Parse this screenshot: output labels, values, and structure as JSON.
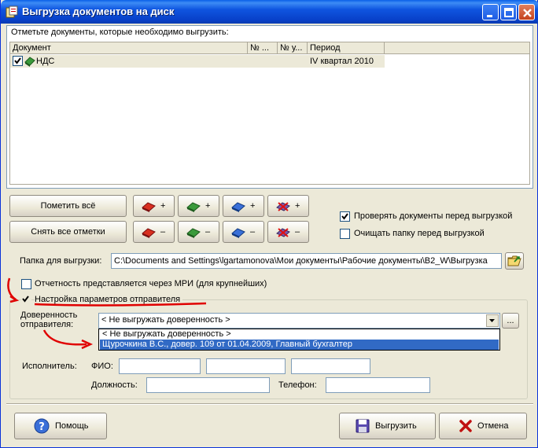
{
  "window": {
    "title": "Выгрузка документов на диск",
    "colors": {
      "titlebar": "#0840c8",
      "face": "#ece9d8",
      "selection": "#316ac5",
      "annotation": "#e00000"
    }
  },
  "documents_panel": {
    "hint": "Отметьте документы, которые необходимо выгрузить:",
    "columns": [
      "Документ",
      "№ ...",
      "№ у...",
      "Период"
    ],
    "rows": [
      {
        "checked": true,
        "document": "НДС",
        "num1": "",
        "num2": "",
        "period": "IV квартал 2010"
      }
    ]
  },
  "buttons": {
    "mark_all": "Пометить всё",
    "unmark_all": "Снять все отметки",
    "plus": "+",
    "minus": "–",
    "help": "Помощь",
    "export": "Выгрузить",
    "cancel": "Отмена",
    "ellipsis": "..."
  },
  "options": {
    "check_documents": {
      "label": "Проверять документы перед выгрузкой",
      "checked": true
    },
    "clear_folder": {
      "label": "Очищать папку перед выгрузкой",
      "checked": false
    }
  },
  "folder": {
    "label": "Папка для выгрузки:",
    "value": "C:\\Documents and Settings\\lgartamonova\\Мои документы\\Рабочие документы\\B2_W\\Выгрузка"
  },
  "mri": {
    "label": "Отчетность представляется через МРИ (для крупнейших)",
    "checked": false
  },
  "sender": {
    "label": "Настройка параметров отправителя",
    "checked": true,
    "proxy_label": "Доверенность отправителя:",
    "proxy_value": "< Не выгружать доверенность >",
    "proxy_options": [
      "< Не выгружать доверенность >",
      "Щурочкина В.С., довер. 109 от 01.04.2009, Главный бухгалтер"
    ],
    "proxy_selected_index": 1,
    "executor_label": "Исполнитель:",
    "fio_label": "ФИО:",
    "fio_values": [
      "",
      "",
      ""
    ],
    "position_label": "Должность:",
    "position_value": "",
    "phone_label": "Телефон:",
    "phone_value": ""
  }
}
